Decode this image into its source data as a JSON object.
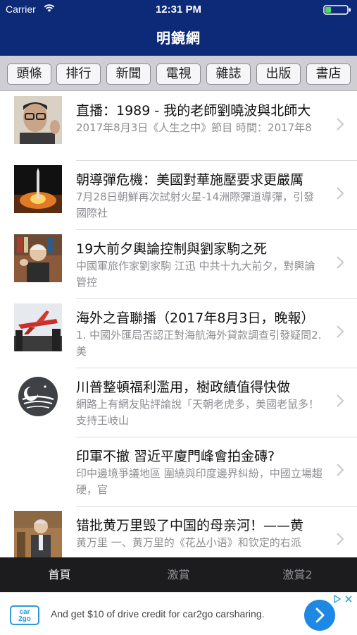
{
  "status_bar": {
    "carrier": "Carrier",
    "time": "12:31 PM"
  },
  "header": {
    "title": "明鏡網"
  },
  "categories": [
    "頭條",
    "排行",
    "新聞",
    "電視",
    "雜誌",
    "出版",
    "書店"
  ],
  "news": [
    {
      "title": "直播：1989 - 我的老師劉曉波與北師大",
      "summary": "2017年8月3日《人生之中》節目 時間：2017年8"
    },
    {
      "title": "朝導彈危機：美國對華施壓要求更嚴厲",
      "summary": "7月28日朝鮮再次試射火星-14洲際彈道導彈，引發國際社"
    },
    {
      "title": "19大前夕輿論控制與劉家駒之死",
      "summary": "中國軍旅作家劉家駒 江迅 中共十九大前夕，對輿論管控"
    },
    {
      "title": "海外之音聯播（2017年8月3日，晚報）",
      "summary": "1. 中國外匯局否認正對海航海外貸款調查引發疑問2. 美"
    },
    {
      "title": "川普整頓福利濫用，樹政績值得快做",
      "summary": "網路上有網友貼評論說「天朝老虎多，美國老鼠多！支持王岐山"
    },
    {
      "title": "印軍不撤 習近平廈門峰會拍金磚?",
      "summary": "印中邊境爭議地區 圍繞與印度邊界糾紛，中國立場趨硬，官"
    },
    {
      "title": "错批黄万里毁了中国的母亲河！——黄",
      "summary": "黄万里 一、黄万里的《花丛小语》和钦定的右派"
    }
  ],
  "tabs": [
    {
      "label": "首頁",
      "active": true
    },
    {
      "label": "激賞",
      "active": false
    },
    {
      "label": "激賞2",
      "active": false
    }
  ],
  "ad": {
    "logo_text": "car2go",
    "text": "And get $10 of drive credit for car2go carsharing."
  },
  "colors": {
    "nav": "#0c2a78",
    "tab_active": "#ffffff",
    "tab_inactive": "#8e8e93",
    "ad_button": "#1e88e5"
  }
}
